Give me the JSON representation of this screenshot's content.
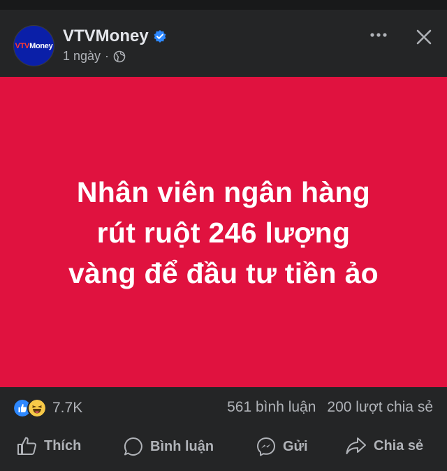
{
  "post": {
    "page_name": "VTVMoney",
    "avatar_text_prefix": "VTV",
    "avatar_text_suffix": "Money",
    "time": "1 ngày",
    "separator": "·",
    "audience_icon": "globe-icon",
    "verified_icon": "verified-badge-icon",
    "headline_lines": [
      "Nhân viên ngân hàng",
      "rút ruột 246 lượng",
      "vàng để đầu tư tiền ảo"
    ],
    "banner_color": "#e0123f"
  },
  "stats": {
    "reaction_icons": [
      "like-reaction-icon",
      "haha-reaction-icon"
    ],
    "reaction_count": "7.7K",
    "comments": "561 bình luận",
    "shares": "200 lượt chia sẻ"
  },
  "actions": {
    "like": "Thích",
    "comment": "Bình luận",
    "send": "Gửi",
    "share": "Chia sẻ"
  },
  "colors": {
    "background": "#242526",
    "text_primary": "#e4e6eb",
    "text_secondary": "#b0b3b8",
    "verified_blue": "#2d88ff"
  }
}
